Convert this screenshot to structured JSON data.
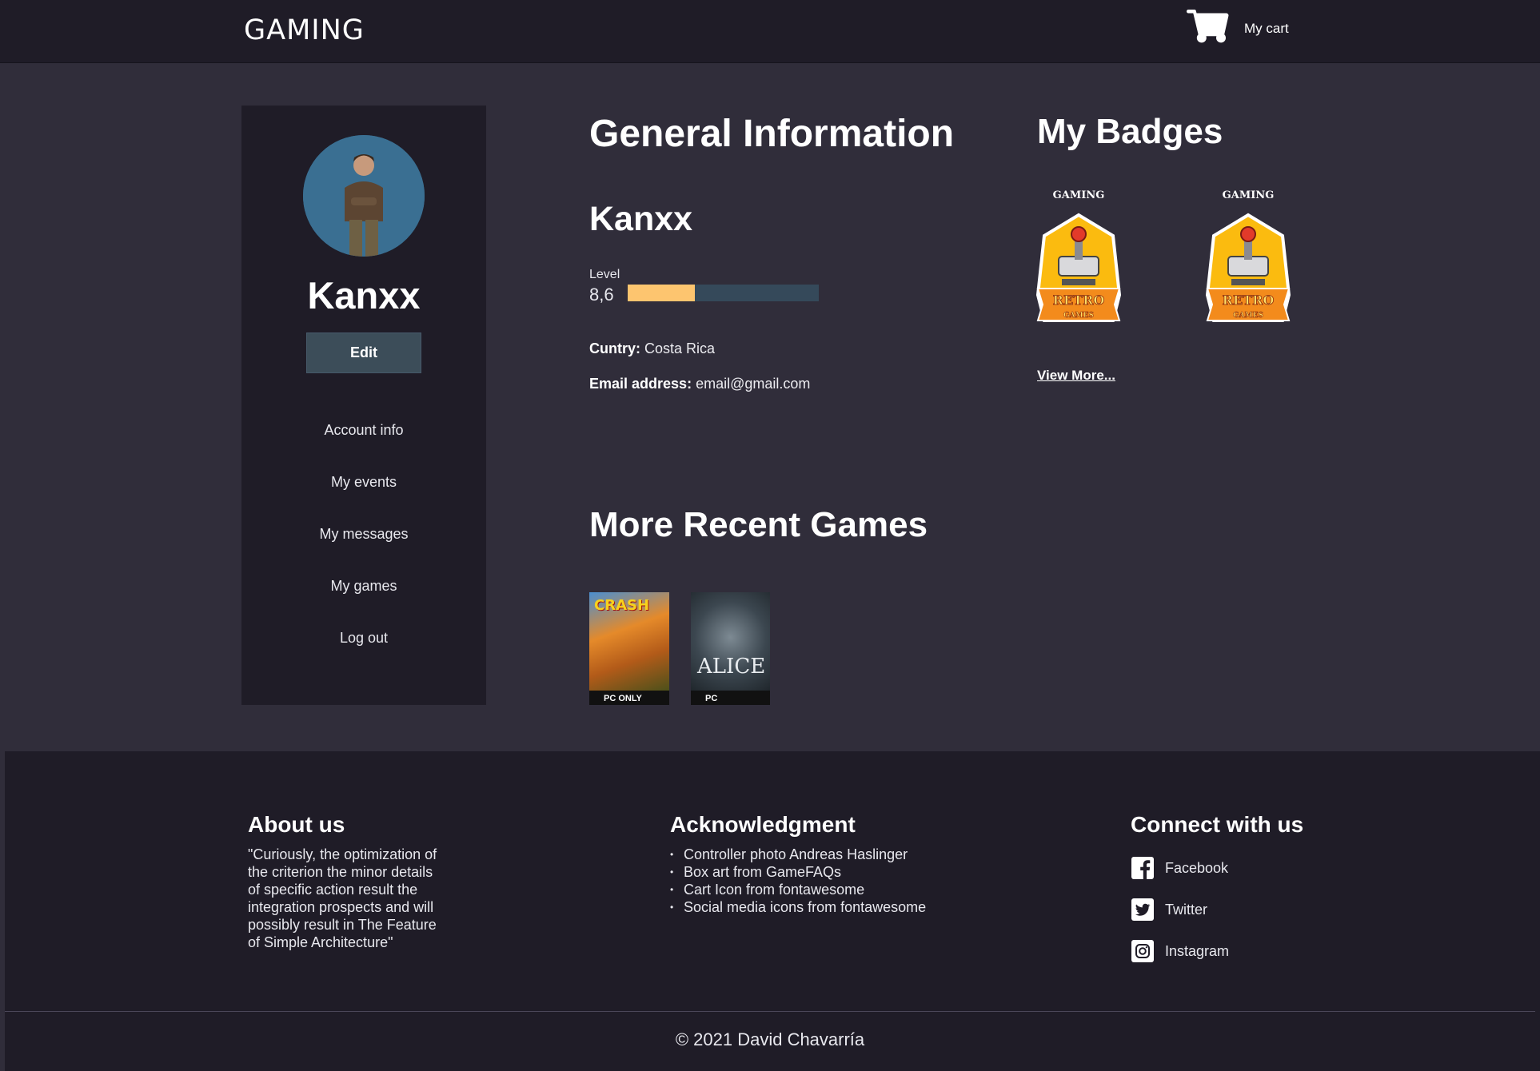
{
  "header": {
    "brand": "GAMING",
    "cart_label": "My cart"
  },
  "sidebar": {
    "name": "Kanxx",
    "edit_label": "Edit",
    "items": [
      {
        "label": "Account info"
      },
      {
        "label": "My events"
      },
      {
        "label": "My messages"
      },
      {
        "label": "My games"
      },
      {
        "label": "Log out"
      }
    ]
  },
  "general": {
    "heading": "General Information",
    "username": "Kanxx",
    "level_label": "Level",
    "level_value": "8,6",
    "level_progress_fraction": 0.35,
    "country_label": "Cuntry:",
    "country_value": "Costa Rica",
    "email_label": "Email address:",
    "email_value": "email@gmail.com"
  },
  "badges": {
    "heading": "My Badges",
    "items": [
      {
        "title": "GAMING",
        "ribbon_top": "RETRO",
        "ribbon_bottom": "GAMES"
      },
      {
        "title": "GAMING",
        "ribbon_top": "RETRO",
        "ribbon_bottom": "GAMES"
      }
    ],
    "view_more": "View More..."
  },
  "recent_games": {
    "heading": "More Recent Games",
    "items": [
      {
        "title": "CRASH",
        "platform": "PC ONLY"
      },
      {
        "title": "ALICE",
        "platform": "PC"
      }
    ]
  },
  "footer": {
    "about_heading": "About us",
    "about_text": "\"Curiously, the optimization of the criterion the minor details of specific action result the integration prospects and will possibly result in The Feature of Simple Architecture\"",
    "ack_heading": "Acknowledgment",
    "ack_items": [
      "Controller photo Andreas Haslinger",
      "Box art from GameFAQs",
      "Cart Icon from fontawesome",
      "Social media icons from fontawesome"
    ],
    "connect_heading": "Connect with us",
    "social": [
      {
        "label": "Facebook",
        "icon": "facebook-icon"
      },
      {
        "label": "Twitter",
        "icon": "twitter-icon"
      },
      {
        "label": "Instagram",
        "icon": "instagram-icon"
      }
    ],
    "copyright": "© 2021 David Chavarría"
  },
  "colors": {
    "page_bg": "#302d3a",
    "panel_bg": "#1f1c27",
    "level_fill": "#fdc56f",
    "level_track": "#35495a",
    "edit_button": "#3c4d59",
    "badge_gold": "#fbbb0f"
  }
}
